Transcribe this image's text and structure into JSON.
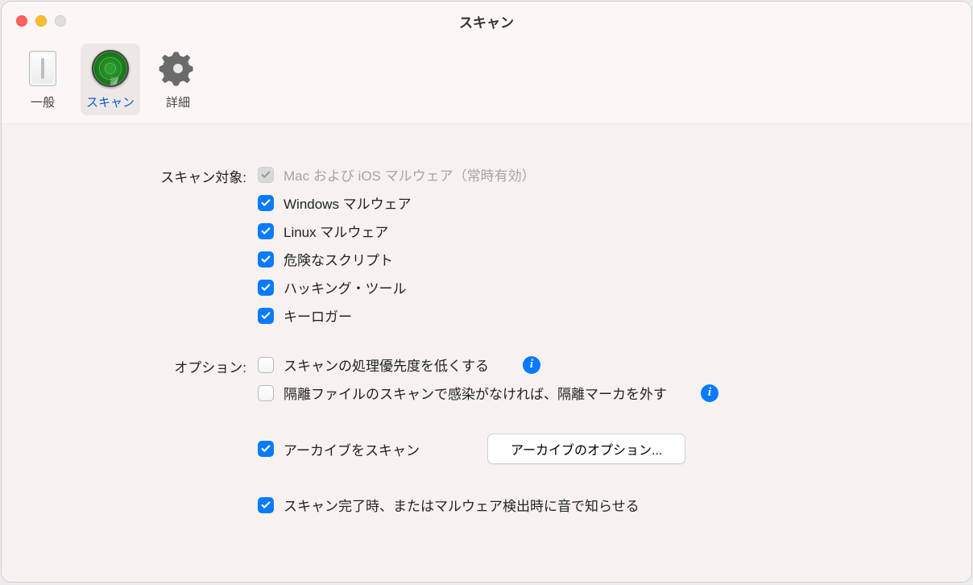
{
  "window": {
    "title": "スキャン"
  },
  "toolbar": {
    "general": "一般",
    "scan": "スキャン",
    "advanced": "詳細"
  },
  "scan_targets": {
    "label": "スキャン対象:",
    "items": [
      {
        "label": "Mac および iOS マルウェア（常時有効）",
        "checked": true,
        "disabled": true
      },
      {
        "label": "Windows マルウェア",
        "checked": true,
        "disabled": false
      },
      {
        "label": "Linux マルウェア",
        "checked": true,
        "disabled": false
      },
      {
        "label": "危険なスクリプト",
        "checked": true,
        "disabled": false
      },
      {
        "label": "ハッキング・ツール",
        "checked": true,
        "disabled": false
      },
      {
        "label": "キーロガー",
        "checked": true,
        "disabled": false
      }
    ]
  },
  "options": {
    "label": "オプション:",
    "low_priority": {
      "label": "スキャンの処理優先度を低くする",
      "checked": false
    },
    "quarantine": {
      "label": "隔離ファイルのスキャンで感染がなければ、隔離マーカを外す",
      "checked": false
    },
    "archive_scan": {
      "label": "アーカイブをスキャン",
      "checked": true
    },
    "archive_button": "アーカイブのオプション...",
    "sound": {
      "label": "スキャン完了時、またはマルウェア検出時に音で知らせる",
      "checked": true
    }
  }
}
